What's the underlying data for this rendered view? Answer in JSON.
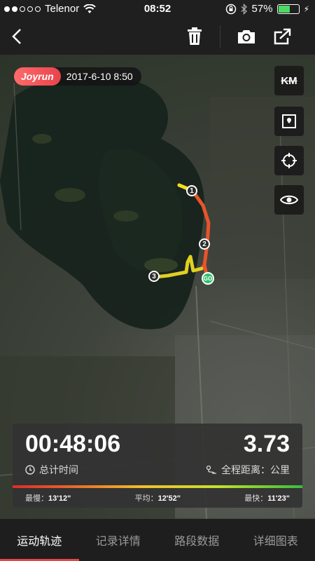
{
  "status_bar": {
    "carrier": "Telenor",
    "time": "08:52",
    "battery_percent": "57%"
  },
  "map": {
    "brand": "Joyrun",
    "datetime": "2017-6-10 8:50",
    "markers": [
      "1",
      "2",
      "3"
    ],
    "start_label": "GO",
    "tools": [
      "km-toggle-icon",
      "map-layer-icon",
      "locate-icon",
      "eye-icon"
    ],
    "km_tool_label": "KM"
  },
  "stats": {
    "total_time": "00:48:06",
    "total_time_label": "总计时间",
    "distance": "3.73",
    "distance_label": "全程距离：公里",
    "slowest_label": "最慢：",
    "slowest_value": "13'12\"",
    "average_label": "平均：",
    "average_value": "12'52\"",
    "fastest_label": "最快：",
    "fastest_value": "11'23\""
  },
  "tabs": [
    {
      "label": "运动轨迹",
      "active": true
    },
    {
      "label": "记录详情",
      "active": false
    },
    {
      "label": "路段数据",
      "active": false
    },
    {
      "label": "详细图表",
      "active": false
    }
  ],
  "colors": {
    "accent": "#e0474c",
    "route_start": "#f0e020",
    "route_slow": "#e84a2b",
    "go_green": "#2ec26a"
  }
}
